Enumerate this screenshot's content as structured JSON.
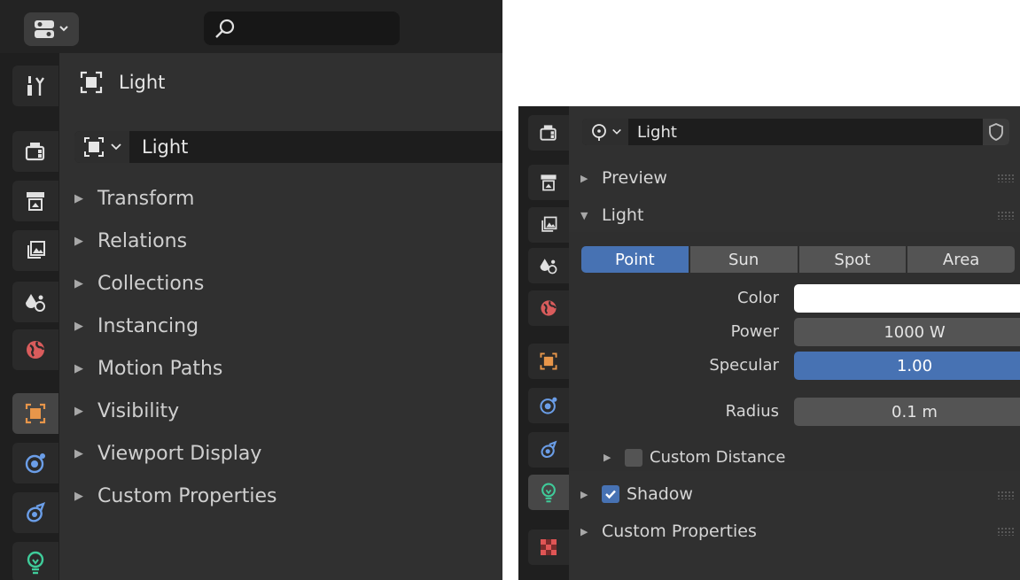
{
  "left": {
    "context_label": "Light",
    "datablock_name": "Light",
    "sections": [
      {
        "label": "Transform"
      },
      {
        "label": "Relations"
      },
      {
        "label": "Collections"
      },
      {
        "label": "Instancing"
      },
      {
        "label": "Motion Paths"
      },
      {
        "label": "Visibility"
      },
      {
        "label": "Viewport Display"
      },
      {
        "label": "Custom Properties"
      }
    ],
    "tabs": [
      "tool-icon",
      "render-icon",
      "output-icon",
      "view-layer-icon",
      "scene-icon",
      "world-icon",
      "object-icon",
      "physics-icon",
      "constraints-icon",
      "light-data-icon"
    ],
    "active_tab": "object-icon"
  },
  "right": {
    "datablock_name": "Light",
    "sections": {
      "preview": "Preview",
      "light": "Light",
      "custom_distance": "Custom Distance",
      "shadow": "Shadow",
      "custom_properties": "Custom Properties"
    },
    "light_types": [
      "Point",
      "Sun",
      "Spot",
      "Area"
    ],
    "selected_type": "Point",
    "props": {
      "color_label": "Color",
      "color_value": "#ffffff",
      "power_label": "Power",
      "power_value": "1000 W",
      "specular_label": "Specular",
      "specular_value": "1.00",
      "radius_label": "Radius",
      "radius_value": "0.1 m"
    },
    "custom_distance_checked": false,
    "shadow_checked": true,
    "tabs": [
      "render-icon",
      "output-icon",
      "view-layer-icon",
      "scene-icon",
      "world-icon",
      "object-icon",
      "physics-icon",
      "constraints-icon",
      "light-data-icon",
      "texture-icon"
    ],
    "active_tab": "light-data-icon"
  },
  "colors": {
    "accent_blue": "#4772b3",
    "object_orange": "#e8964a",
    "physics_blue": "#6b9ee8",
    "light_green": "#3fcc9a",
    "world_red": "#d95c5c"
  }
}
